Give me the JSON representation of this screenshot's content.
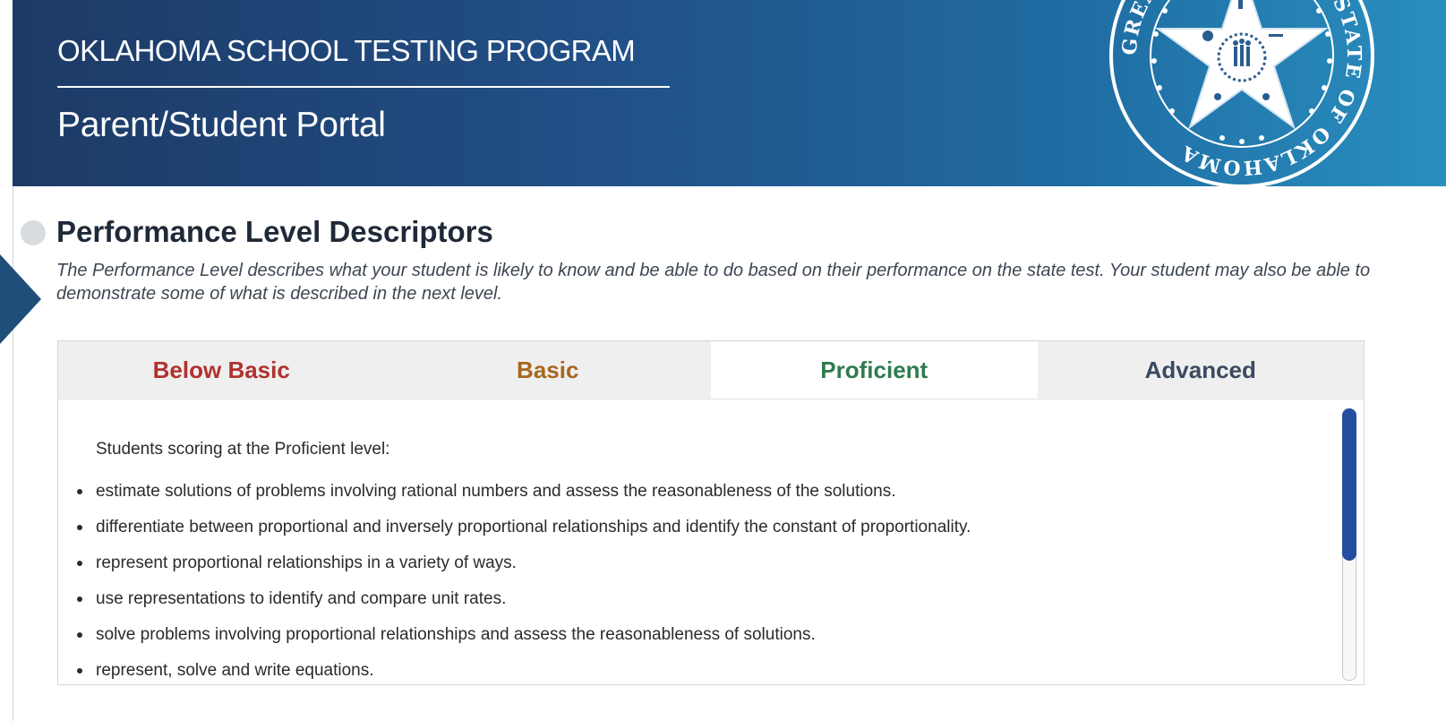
{
  "header": {
    "program_title": "OKLAHOMA SCHOOL TESTING PROGRAM",
    "portal_title": "Parent/Student Portal",
    "seal_text": "GREAT SEAL OF THE STATE OF OKLAHOMA"
  },
  "section": {
    "title": "Performance Level Descriptors",
    "description": "The Performance Level describes what your student is likely to know and be able to do based on their performance on the state test. Your student may also be able to demonstrate some of what is described in the next level."
  },
  "tabs": [
    {
      "label": "Below Basic",
      "color": "#b0322f",
      "active": false
    },
    {
      "label": "Basic",
      "color": "#a8671e",
      "active": false
    },
    {
      "label": "Proficient",
      "color": "#2f7b4f",
      "active": true
    },
    {
      "label": "Advanced",
      "color": "#3b4a60",
      "active": false
    }
  ],
  "panel": {
    "intro": "Students scoring at the Proficient level:",
    "items": [
      "estimate solutions of problems involving rational numbers and assess the reasonableness of the solutions.",
      "differentiate between proportional and inversely proportional relationships and identify the constant of proportionality.",
      "represent proportional relationships in a variety of ways.",
      "use representations to identify and compare unit rates.",
      "solve problems involving proportional relationships and assess the reasonableness of solutions.",
      "represent, solve and write equations."
    ]
  },
  "colors": {
    "header_dark": "#1d3a66",
    "header_light": "#2a8fbf",
    "scroll_thumb": "#234ea0"
  }
}
